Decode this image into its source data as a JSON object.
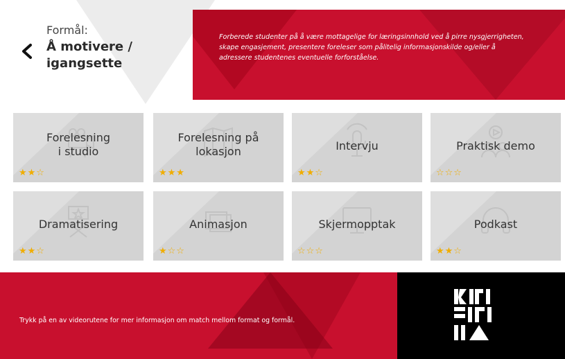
{
  "header": {
    "purpose_label": "Formål:",
    "purpose_title": "Å motivere / igangsette",
    "description": "Forberede studenter på å være mottagelige for læringsinnhold ved å pirre nysgjerrigheten, skape engasjement, presentere foreleser som pålitelig informasjonskilde og/eller å adressere studentenes eventuelle forforståelse."
  },
  "tiles": [
    {
      "label": "Forelesning\ni studio",
      "icon": "camera-icon",
      "rating": 2,
      "stars": "★★☆"
    },
    {
      "label": "Forelesning på\nlokasjon",
      "icon": "map-icon",
      "rating": 3,
      "stars": "★★★"
    },
    {
      "label": "Intervju",
      "icon": "microphone-icon",
      "rating": 2,
      "stars": "★★☆"
    },
    {
      "label": "Praktisk demo",
      "icon": "presenter-icon",
      "rating": 0,
      "stars": "☆☆☆"
    },
    {
      "label": "Dramatisering",
      "icon": "directors-chair-icon",
      "rating": 2,
      "stars": "★★☆"
    },
    {
      "label": "Animasjon",
      "icon": "film-frames-icon",
      "rating": 1,
      "stars": "★☆☆"
    },
    {
      "label": "Skjermopptak",
      "icon": "monitor-icon",
      "rating": 0,
      "stars": "☆☆☆"
    },
    {
      "label": "Podkast",
      "icon": "headphones-icon",
      "rating": 2,
      "stars": "★★☆"
    }
  ],
  "footer": {
    "instruction": "Trykk på en av videorutene for mer informasjon om match mellom format og formål."
  },
  "colors": {
    "accent_red": "#c8102e",
    "tile_gray": "#d3d3d3",
    "star_gold": "#f0ad00",
    "footer_black": "#000000"
  }
}
